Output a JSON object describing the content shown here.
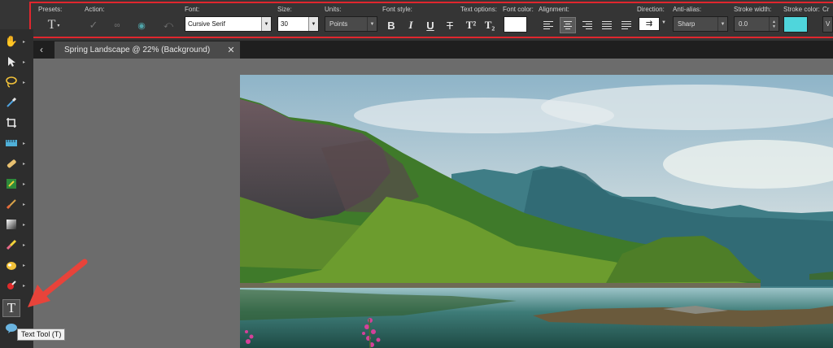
{
  "options_bar": {
    "presets_label": "Presets:",
    "action_label": "Action:",
    "font_label": "Font:",
    "font_value": "Cursive Serif",
    "size_label": "Size:",
    "size_value": "30",
    "units_label": "Units:",
    "units_value": "Points",
    "font_style_label": "Font style:",
    "text_options_label": "Text options:",
    "font_color_label": "Font color:",
    "alignment_label": "Alignment:",
    "direction_label": "Direction:",
    "anti_alias_label": "Anti-alias:",
    "anti_alias_value": "Sharp",
    "stroke_width_label": "Stroke width:",
    "stroke_width_value": "0.0",
    "stroke_color_label": "Stroke color:",
    "cr_label": "Cr",
    "v_label": "V",
    "font_color": "#ffffff",
    "stroke_color": "#4fd6dc",
    "highlight_color": "#e0262e",
    "icons": {
      "bold": "B",
      "italic": "I",
      "underline": "U",
      "strike": "T",
      "superscript": "T²",
      "subscript": "T₂"
    }
  },
  "tab": {
    "title": "Spring Landscape @  22% (Background)",
    "close": "✕",
    "back": "‹"
  },
  "tooltip": {
    "text": "Text Tool (T)"
  },
  "toolbar": {
    "tools": [
      "pan-tool",
      "pick-tool",
      "selection-tool",
      "dropper-tool",
      "crop-tool",
      "straighten-tool",
      "makeover-tool",
      "clone-tool",
      "paint-brush-tool",
      "gradient-tool",
      "eraser-tool",
      "color-changer-tool",
      "red-eye-tool",
      "text-tool",
      "shape-tool"
    ]
  }
}
